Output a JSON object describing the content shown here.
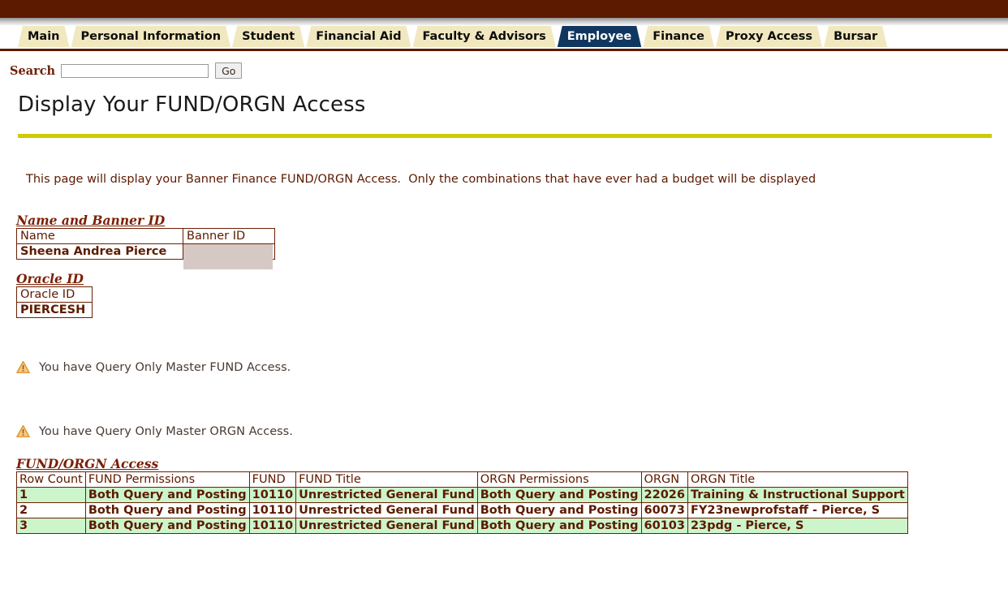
{
  "theme": {
    "banner_color": "#5c1a00",
    "tab_fill": "#f2e8c0",
    "tab_selected_fill": "#10375f",
    "title_rule_color": "#cccc00",
    "row_highlight": "#ccf5cc",
    "text_maroon": "#5c1a00",
    "warning_color": "#e8a33d"
  },
  "tabs": [
    {
      "label": "Main",
      "selected": false
    },
    {
      "label": "Personal Information",
      "selected": false
    },
    {
      "label": "Student",
      "selected": false
    },
    {
      "label": "Financial Aid",
      "selected": false
    },
    {
      "label": "Faculty & Advisors",
      "selected": false
    },
    {
      "label": "Employee",
      "selected": true
    },
    {
      "label": "Finance",
      "selected": false
    },
    {
      "label": "Proxy Access",
      "selected": false
    },
    {
      "label": "Bursar",
      "selected": false
    }
  ],
  "search": {
    "label": "Search",
    "value": "",
    "placeholder": "",
    "button_label": "Go"
  },
  "page": {
    "title": "Display Your FUND/ORGN Access",
    "intro": "This page will display your Banner Finance FUND/ORGN Access.  Only the combinations that have ever had a budget will be displayed"
  },
  "name_section": {
    "heading": "Name and Banner ID",
    "columns": [
      "Name",
      "Banner ID"
    ],
    "row": {
      "name": "Sheena Andrea Pierce",
      "banner_id": ""
    }
  },
  "oracle_section": {
    "heading": "Oracle ID",
    "columns": [
      "Oracle ID"
    ],
    "row": {
      "oracle_id": "PIERCESH"
    }
  },
  "warnings": [
    {
      "icon": "warning-triangle-icon",
      "text": "You have Query Only Master FUND Access."
    },
    {
      "icon": "warning-triangle-icon",
      "text": "You have Query Only Master ORGN Access."
    }
  ],
  "access_section": {
    "heading": "FUND/ORGN Access",
    "columns": [
      "Row Count",
      "FUND Permissions",
      "FUND",
      "FUND Title",
      "ORGN Permissions",
      "ORGN",
      "ORGN Title"
    ],
    "rows": [
      {
        "row_count": "1",
        "fund_permissions": "Both Query and Posting",
        "fund": "10110",
        "fund_title": "Unrestricted General Fund",
        "orgn_permissions": "Both Query and Posting",
        "orgn": "22026",
        "orgn_title": "Training & Instructional Support",
        "shade": "green"
      },
      {
        "row_count": "2",
        "fund_permissions": "Both Query and Posting",
        "fund": "10110",
        "fund_title": "Unrestricted General Fund",
        "orgn_permissions": "Both Query and Posting",
        "orgn": "60073",
        "orgn_title": "FY23newprofstaff - Pierce, S",
        "shade": "white"
      },
      {
        "row_count": "3",
        "fund_permissions": "Both Query and Posting",
        "fund": "10110",
        "fund_title": "Unrestricted General Fund",
        "orgn_permissions": "Both Query and Posting",
        "orgn": "60103",
        "orgn_title": "23pdg - Pierce, S",
        "shade": "green"
      }
    ]
  }
}
